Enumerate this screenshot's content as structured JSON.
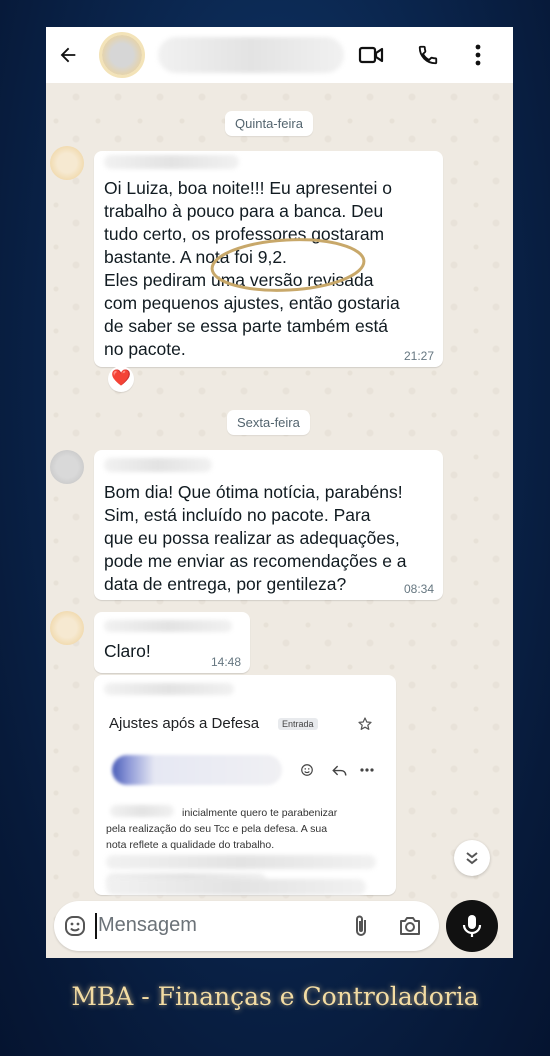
{
  "chat": {
    "date_thursday": "Quinta-feira",
    "date_friday": "Sexta-feira",
    "messages": [
      {
        "text": "Oi Luiza, boa noite!!! Eu apresentei o\ntrabalho à pouco para a banca. Deu\ntudo certo, os professores gostaram\nbastante. A nota foi 9,2.\nEles pediram uma versão revisada\ncom pequenos ajustes, então gostaria\nde saber se essa parte também está\nno pacote.",
        "time": "21:27",
        "reaction": "❤️"
      },
      {
        "text": "Bom dia! Que ótima notícia, parabéns!\nSim, está incluído no pacote. Para\nque eu possa realizar as adequações,\npode me enviar as recomendações e a\ndata de entrega, por gentileza?",
        "time": "08:34"
      },
      {
        "text": "Claro!",
        "time": "14:48"
      }
    ],
    "email_card": {
      "subject": "Ajustes após a Defesa",
      "tag": "Entrada",
      "body": "inicialmente quero te parabenizar\npela realização do seu Tcc e pela defesa. A sua\nnota reflete a qualidade do trabalho."
    }
  },
  "input": {
    "placeholder": "Mensagem"
  },
  "caption": "MBA - Finanças e Controladoria",
  "icons": {
    "back": "arrow-left-icon",
    "video": "video-icon",
    "call": "phone-icon",
    "menu": "more-vertical-icon",
    "emoji": "emoji-icon",
    "attach": "paperclip-icon",
    "camera": "camera-icon",
    "mic": "microphone-icon",
    "scroll": "double-chevron-down-icon",
    "star": "star-icon",
    "reply": "reply-icon"
  },
  "colors": {
    "chat_bg": "#efeae2",
    "highlight_ring": "#c8a86a",
    "caption": "#f3dca3"
  }
}
